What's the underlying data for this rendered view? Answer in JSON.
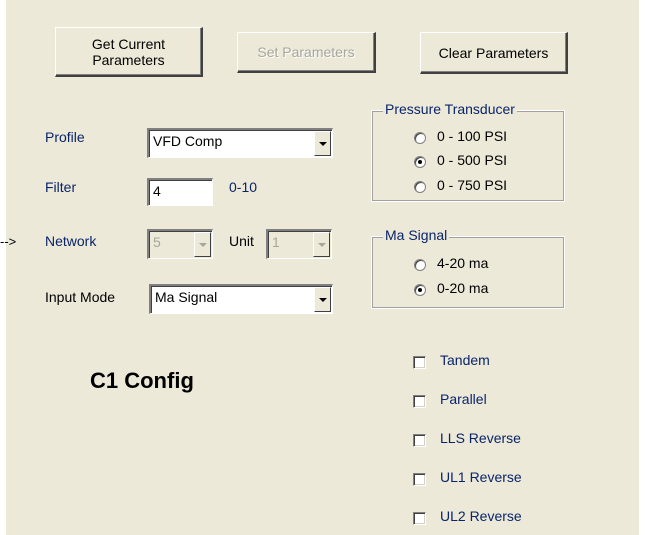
{
  "buttons": {
    "get_current": "Get Current\nParameters",
    "set_params": "Set Parameters",
    "clear_params": "Clear Parameters"
  },
  "profile": {
    "label": "Profile",
    "value": "VFD Comp"
  },
  "filter": {
    "label": "Filter",
    "value": "4",
    "range": "0-10"
  },
  "network": {
    "arrow": "-->",
    "label": "Network",
    "value": "5",
    "unit_label": "Unit",
    "unit_value": "1"
  },
  "input_mode": {
    "label": "Input Mode",
    "value": "Ma Signal"
  },
  "pressure": {
    "title": "Pressure Transducer",
    "options": [
      {
        "label": "0 - 100 PSI",
        "selected": false
      },
      {
        "label": "0 - 500 PSI",
        "selected": true
      },
      {
        "label": "0 - 750 PSI",
        "selected": false
      }
    ]
  },
  "ma_signal": {
    "title": "Ma Signal",
    "options": [
      {
        "label": "4-20 ma",
        "selected": false
      },
      {
        "label": "0-20 ma",
        "selected": true
      }
    ]
  },
  "checkboxes": [
    {
      "label": "Tandem",
      "checked": false
    },
    {
      "label": "Parallel",
      "checked": false
    },
    {
      "label": "LLS Reverse",
      "checked": false
    },
    {
      "label": "UL1 Reverse",
      "checked": false
    },
    {
      "label": "UL2 Reverse",
      "checked": false
    }
  ],
  "heading": "C1 Config"
}
